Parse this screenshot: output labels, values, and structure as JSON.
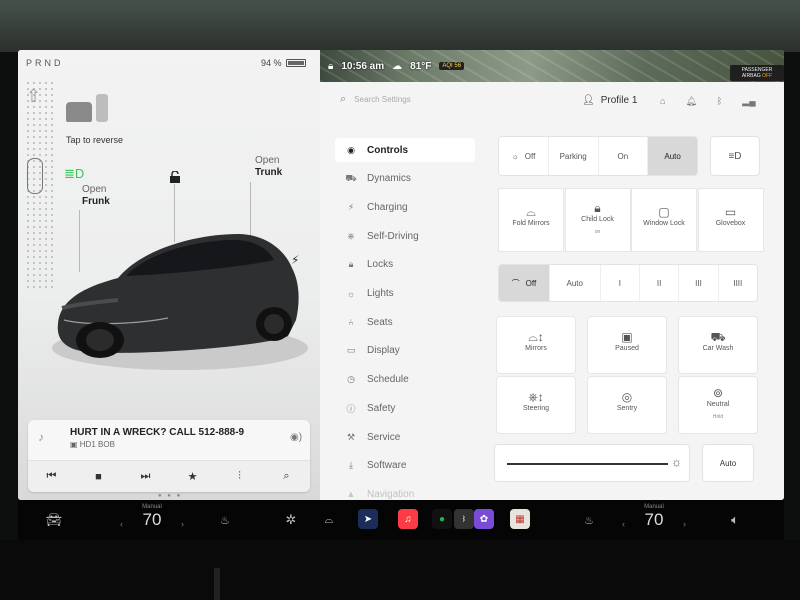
{
  "gear": "PRND",
  "battery": {
    "percent_label": "94 %",
    "level": 0.94
  },
  "car_panel": {
    "tap_to_reverse": "Tap to reverse",
    "frunk": {
      "line1": "Open",
      "line2": "Frunk"
    },
    "trunk": {
      "line1": "Open",
      "line2": "Trunk"
    }
  },
  "media": {
    "track": "HURT IN A WRECK? CALL 512-888-9",
    "station": "HD1 BOB",
    "controls": [
      "prev-icon",
      "stop-icon",
      "next-icon",
      "favorite-icon",
      "equalizer-icon",
      "search-icon"
    ]
  },
  "status_bar": {
    "time": "10:56 am",
    "temperature": "81°F",
    "aqi": "AQI 56",
    "airbag_line1": "PASSENGER",
    "airbag_line2": "AIRBAG",
    "airbag_state": "OFF"
  },
  "header": {
    "search_placeholder": "Search Settings",
    "profile": "Profile 1"
  },
  "nav": [
    {
      "label": "Controls",
      "icon": "toggle-icon",
      "active": true
    },
    {
      "label": "Dynamics",
      "icon": "car-icon"
    },
    {
      "label": "Charging",
      "icon": "bolt-icon"
    },
    {
      "label": "Self-Driving",
      "icon": "steering-icon"
    },
    {
      "label": "Locks",
      "icon": "lock-icon"
    },
    {
      "label": "Lights",
      "icon": "light-icon"
    },
    {
      "label": "Seats",
      "icon": "seat-icon"
    },
    {
      "label": "Display",
      "icon": "display-icon"
    },
    {
      "label": "Schedule",
      "icon": "clock-icon"
    },
    {
      "label": "Safety",
      "icon": "safety-icon"
    },
    {
      "label": "Service",
      "icon": "wrench-icon"
    },
    {
      "label": "Software",
      "icon": "download-icon"
    },
    {
      "label": "Navigation",
      "icon": "navigation-icon"
    }
  ],
  "lights": {
    "off": "Off",
    "parking": "Parking",
    "on": "On",
    "auto": "Auto",
    "selected": "Auto"
  },
  "tiles_row1": [
    {
      "label": "Fold Mirrors",
      "sub": ""
    },
    {
      "label": "Child Lock",
      "sub": "on"
    },
    {
      "label": "Window Lock",
      "sub": ""
    },
    {
      "label": "Glovebox",
      "sub": ""
    }
  ],
  "wipers": {
    "off": "Off",
    "auto": "Auto",
    "speeds": [
      "I",
      "II",
      "III",
      "IIII"
    ]
  },
  "tiles_grid": [
    {
      "label": "Mirrors",
      "sub": ""
    },
    {
      "label": "Paused",
      "sub": ""
    },
    {
      "label": "Car Wash",
      "sub": ""
    },
    {
      "label": "Steering",
      "sub": ""
    },
    {
      "label": "Sentry",
      "sub": ""
    },
    {
      "label": "Neutral",
      "sub": "Hold"
    }
  ],
  "brightness": {
    "level": 0.92,
    "auto_label": "Auto"
  },
  "dock": {
    "driver_temp": {
      "label": "Manual",
      "value": "70"
    },
    "passenger_temp": {
      "label": "Manual",
      "value": "70"
    }
  },
  "colors": {
    "accent_green": "#34c759",
    "active_segment": "#d8d8d8",
    "airbag_off": "#ff9f0a",
    "music_red": "#fc3c44"
  }
}
